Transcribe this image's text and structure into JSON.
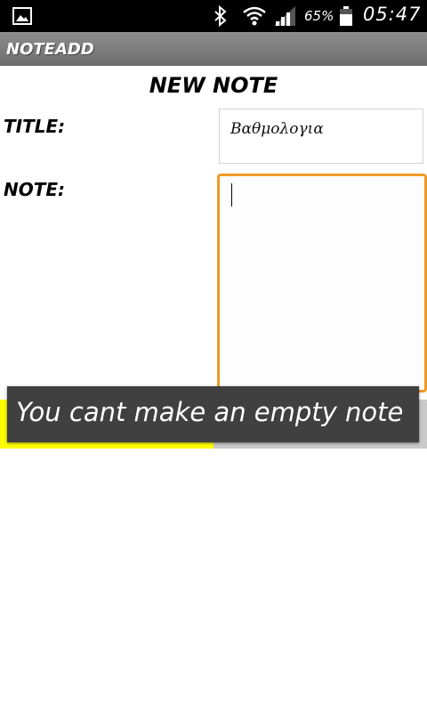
{
  "status_bar": {
    "battery_percent": "65%",
    "time": "05:47",
    "icons": [
      "gallery-icon",
      "bluetooth-icon",
      "wifi-icon",
      "signal-icon",
      "battery-icon"
    ]
  },
  "action_bar": {
    "title": "NOTEADD"
  },
  "form": {
    "heading": "NEW NOTE",
    "title_label": "TITLE:",
    "title_value": "Βαθμολογια",
    "note_label": "NOTE:",
    "note_value": ""
  },
  "toast": {
    "message": "You cant make an empty note"
  },
  "colors": {
    "focus_border": "#f09a26",
    "button_highlight": "#ffff00",
    "toast_bg": "#404040",
    "action_bar": "#7d7d7d"
  }
}
